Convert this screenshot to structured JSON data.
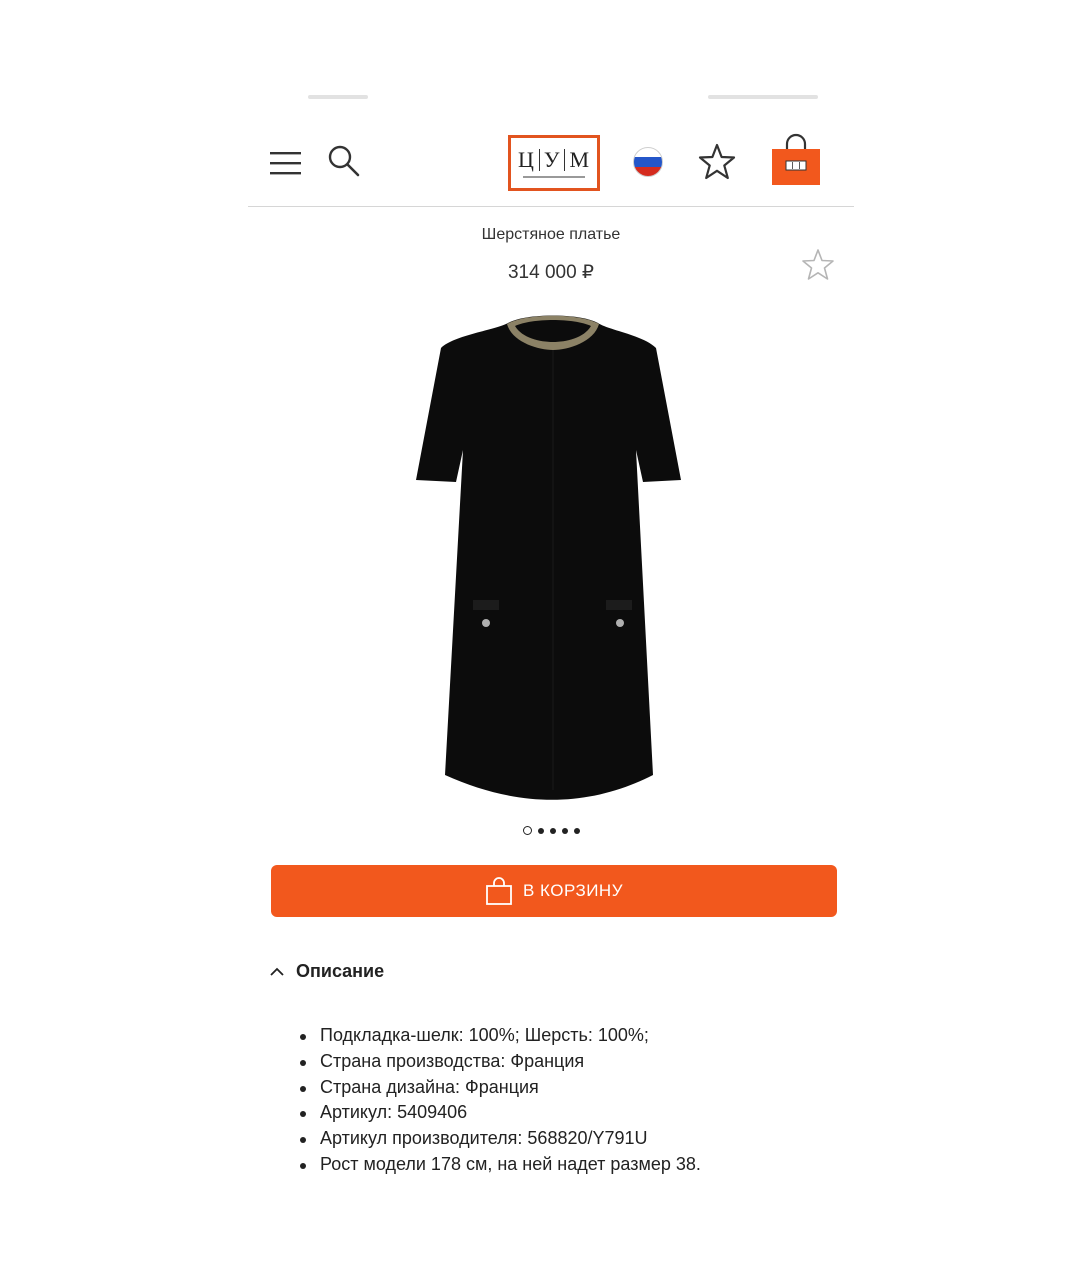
{
  "header": {
    "logo_text": [
      "Ц",
      "У",
      "М"
    ],
    "colors": {
      "accent": "#f2581d",
      "logo_border": "#e2541f"
    },
    "icons": [
      "menu-icon",
      "search-icon",
      "russia-flag-icon",
      "favorite-star-icon",
      "shopping-bag-icon"
    ]
  },
  "product": {
    "title": "Шерстяное платье",
    "price": "314 000 ₽",
    "gallery": {
      "total_images": 5,
      "active_index": 0
    }
  },
  "cart_button": {
    "label": "В КОРЗИНУ"
  },
  "description": {
    "title": "Описание",
    "items": [
      "Подкладка-шелк: 100%; Шерсть: 100%;",
      "Страна производства: Франция",
      "Страна дизайна: Франция",
      "Артикул: 5409406",
      "Артикул производителя: 568820/Y791U",
      "Рост модели 178 см, на ней надет размер 38."
    ]
  }
}
